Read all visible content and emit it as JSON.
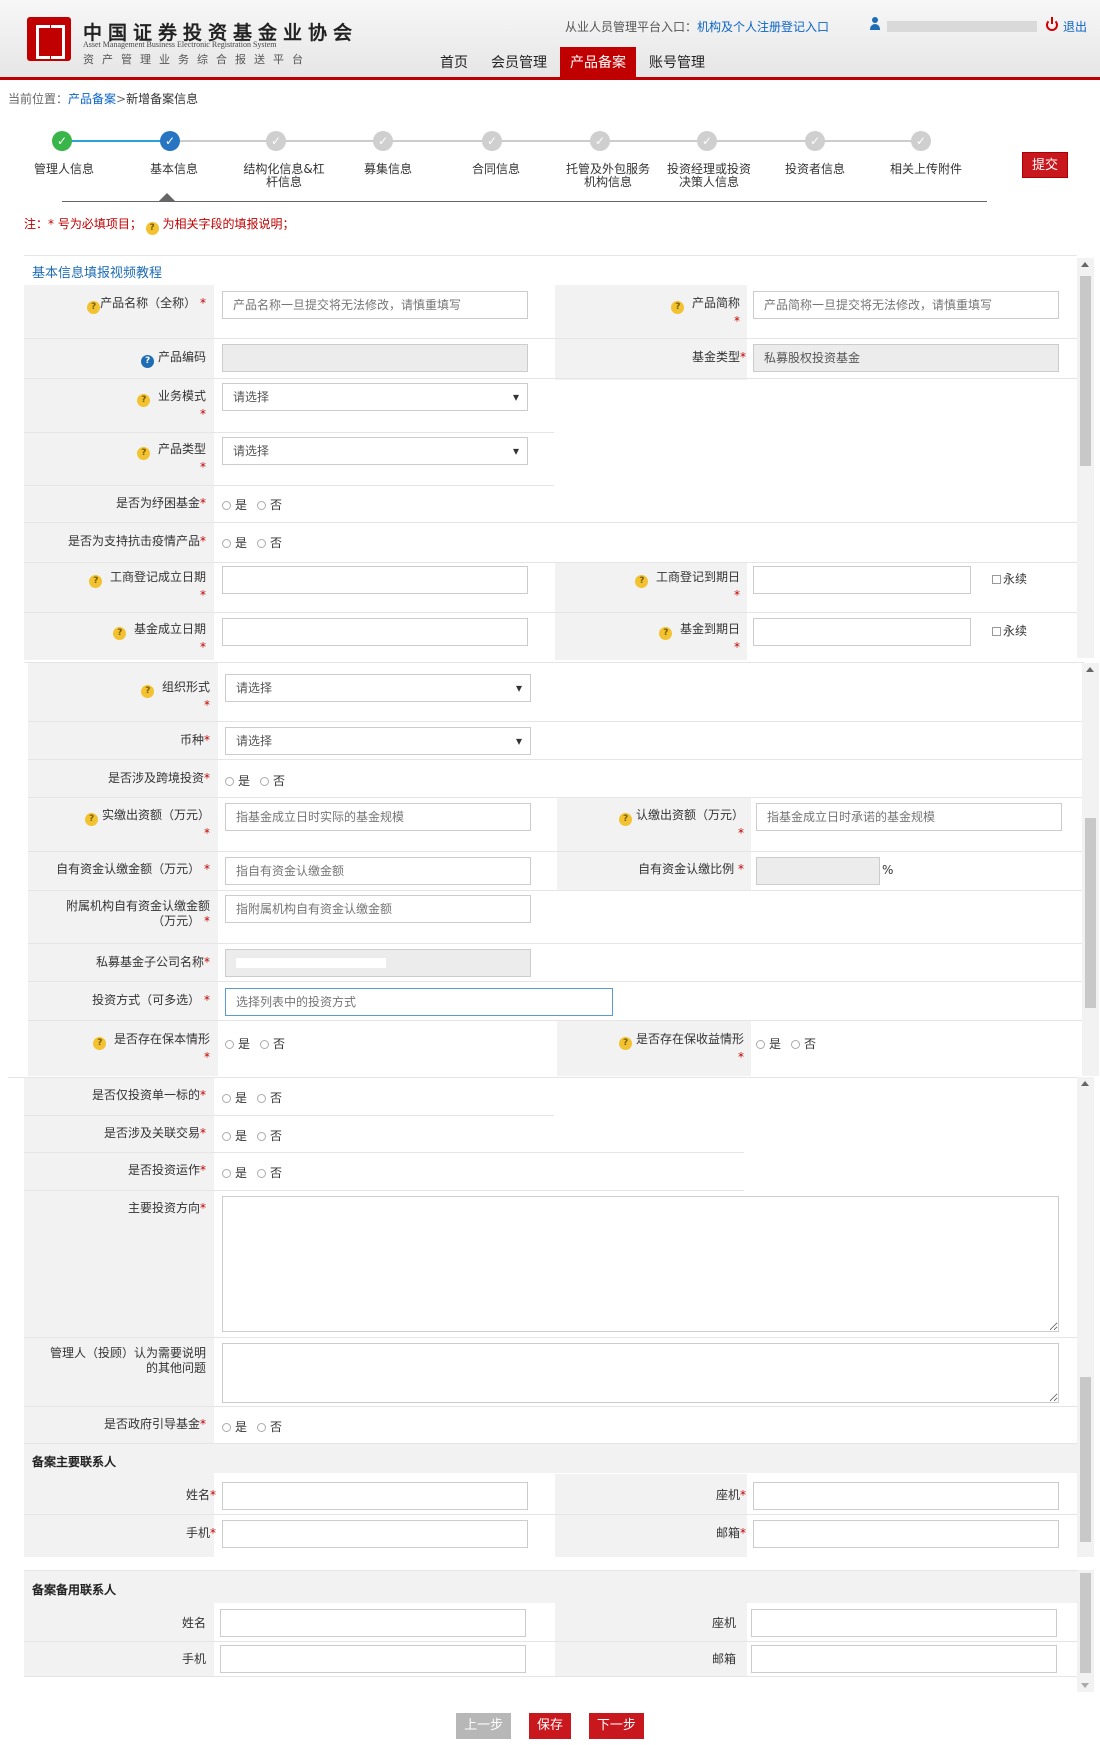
{
  "header": {
    "org_name_cn": "中国证券投资基金业协会",
    "org_name_en": "Asset Management Business Electronic Registration System",
    "system_name": "资产管理业务综合报送平台",
    "portal_prefix": "从业人员管理平台入口：",
    "portal_link": "机构及个人注册登记入口",
    "logout": "退出",
    "nav": [
      "首页",
      "会员管理",
      "产品备案",
      "账号管理"
    ],
    "active_nav": "产品备案"
  },
  "breadcrumb": {
    "prefix": "当前位置：",
    "link": "产品备案",
    "sep": ">",
    "current": "新增备案信息"
  },
  "steps": [
    {
      "label": "管理人信息",
      "status": "done"
    },
    {
      "label": "基本信息",
      "status": "current"
    },
    {
      "label": "结构化信息&杠杆信息",
      "status": "todo"
    },
    {
      "label": "募集信息",
      "status": "todo"
    },
    {
      "label": "合同信息",
      "status": "todo"
    },
    {
      "label": "托管及外包服务机构信息",
      "status": "todo"
    },
    {
      "label": "投资经理或投资决策人信息",
      "status": "todo"
    },
    {
      "label": "投资者信息",
      "status": "todo"
    },
    {
      "label": "相关上传附件",
      "status": "todo"
    }
  ],
  "submit": "提交",
  "note": {
    "part1": "注：* 号为必填项目；",
    "part2": "为相关字段的填报说明；"
  },
  "section_title": "基本信息填报视频教程",
  "fields": {
    "product_name": {
      "label": "产品名称（全称）",
      "placeholder": "产品名称一旦提交将无法修改，请慎重填写"
    },
    "product_short": {
      "label": "产品简称",
      "placeholder": "产品简称一旦提交将无法修改，请慎重填写"
    },
    "product_code": {
      "label": "产品编码"
    },
    "fund_type": {
      "label": "基金类型",
      "value": "私募股权投资基金"
    },
    "business_mode": {
      "label": "业务模式",
      "value": "请选择"
    },
    "product_type": {
      "label": "产品类型",
      "value": "请选择"
    },
    "relief_fund": {
      "label": "是否为纾困基金"
    },
    "anti_epidemic": {
      "label": "是否为支持抗击疫情产品"
    },
    "biz_reg_date": {
      "label": "工商登记成立日期"
    },
    "biz_reg_expiry": {
      "label": "工商登记到期日"
    },
    "fund_est_date": {
      "label": "基金成立日期"
    },
    "fund_expiry": {
      "label": "基金到期日"
    },
    "perpetual": "永续",
    "org_form": {
      "label": "组织形式",
      "value": "请选择"
    },
    "currency": {
      "label": "币种",
      "value": "请选择"
    },
    "cross_border": {
      "label": "是否涉及跨境投资"
    },
    "paid_in": {
      "label": "实缴出资额（万元）",
      "placeholder": "指基金成立日时实际的基金规模"
    },
    "subscribed": {
      "label": "认缴出资额（万元）",
      "placeholder": "指基金成立日时承诺的基金规模"
    },
    "own_amount": {
      "label": "自有资金认缴金额（万元）",
      "placeholder": "指自有资金认缴金额"
    },
    "own_ratio": {
      "label": "自有资金认缴比例",
      "unit": "%"
    },
    "affiliate_amount": {
      "label1": "附属机构自有资金认缴金额",
      "label2": "（万元）",
      "placeholder": "指附属机构自有资金认缴金额"
    },
    "subsidiary_name": {
      "label": "私募基金子公司名称"
    },
    "invest_method": {
      "label": "投资方式（可多选）",
      "placeholder": "选择列表中的投资方式"
    },
    "capital_guarantee": {
      "label": "是否存在保本情形"
    },
    "return_guarantee": {
      "label": "是否存在保收益情形"
    },
    "single_target": {
      "label": "是否仅投资单一标的"
    },
    "related_trade": {
      "label": "是否涉及关联交易"
    },
    "invest_operation": {
      "label": "是否投资运作"
    },
    "main_direction": {
      "label": "主要投资方向"
    },
    "other_issues": {
      "label1": "管理人（投顾）认为需要说明",
      "label2": "的其他问题"
    },
    "gov_guide": {
      "label": "是否政府引导基金"
    }
  },
  "yes": "是",
  "no": "否",
  "contacts": {
    "primary_title": "备案主要联系人",
    "backup_title": "备案备用联系人",
    "name": "姓名",
    "landline": "座机",
    "mobile": "手机",
    "email": "邮箱"
  },
  "buttons": {
    "prev": "上一步",
    "save": "保存",
    "next": "下一步"
  }
}
